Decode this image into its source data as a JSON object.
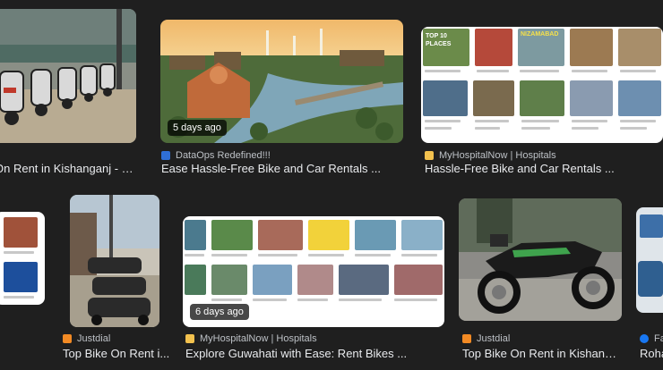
{
  "results": [
    {
      "title": "On Rent in Kishanganj - Be...",
      "source": "",
      "badge": ""
    },
    {
      "title": "Ease Hassle-Free Bike and Car Rentals ...",
      "source": "DataOps Redefined!!!",
      "badge": "5 days ago"
    },
    {
      "title": "Hassle-Free Bike and Car Rentals ...",
      "source": "MyHospitalNow | Hospitals",
      "badge": ""
    },
    {
      "title": "",
      "source": "",
      "badge": ""
    },
    {
      "title": "Top Bike On Rent i...",
      "source": "Justdial",
      "badge": ""
    },
    {
      "title": "Explore Guwahati with Ease: Rent Bikes ...",
      "source": "MyHospitalNow | Hospitals",
      "badge": "6 days ago"
    },
    {
      "title": "Top Bike On Rent in Kishanga...",
      "source": "Justdial",
      "badge": ""
    },
    {
      "title": "Roha",
      "source": "Fa",
      "badge": ""
    }
  ],
  "collage": {
    "top_label": "TOP 10 PLACES",
    "mid_label": "NIZAMABAD"
  },
  "colors": {
    "background": "#1f1f1f",
    "title_text": "#e8eaed",
    "meta_text": "#bdc1c6"
  },
  "icons": {
    "dataops": "dataops-favicon",
    "myhospitalnow": "myhospitalnow-favicon",
    "justdial": "justdial-favicon",
    "facebook": "facebook-favicon"
  }
}
